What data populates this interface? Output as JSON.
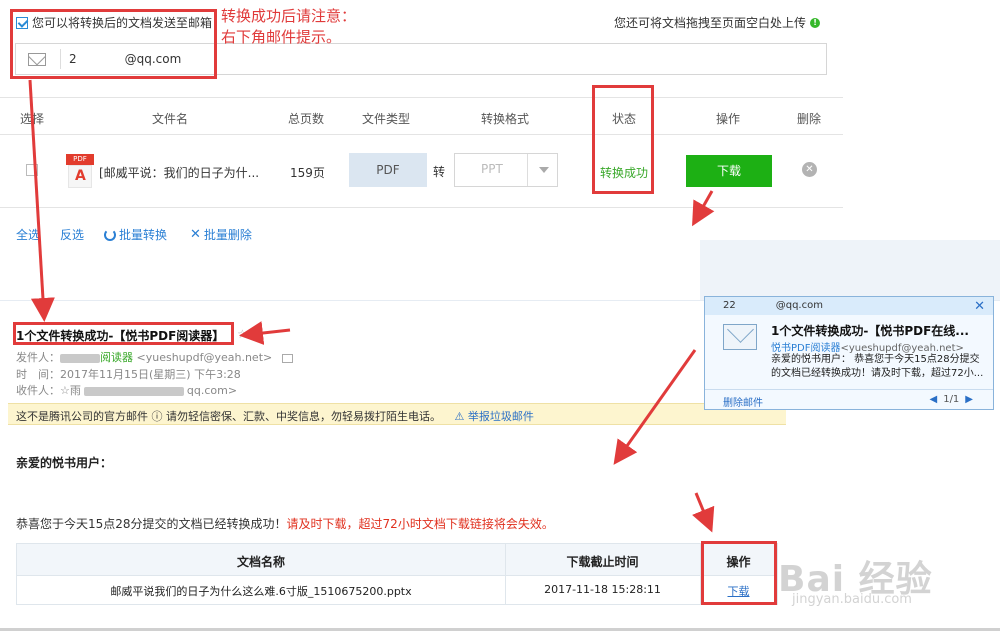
{
  "converter": {
    "email_checkbox_label": "您可以将转换后的文档发送至邮箱",
    "email_value": "2    @qq.com",
    "drag_hint": "您还可将文档拖拽至页面空白处上传",
    "columns": [
      "选择",
      "文件名",
      "总页数",
      "文件类型",
      "转换格式",
      "状态",
      "操作",
      "删除"
    ],
    "row": {
      "file_name": "[邮威平说：我们的日子为什...",
      "pages": "159页",
      "file_type": "PDF",
      "to_label": "转",
      "target_format": "PPT",
      "status": "转换成功",
      "download_label": "下载"
    },
    "bulk": {
      "select_all": "全选",
      "invert": "反选",
      "batch_convert": "批量转换",
      "batch_delete": "批量删除"
    }
  },
  "annotation": {
    "line1": "转换成功后请注意：",
    "line2": "右下角邮件提示。"
  },
  "mail": {
    "subject": "1个文件转换成功-【悦书PDF阅读器】",
    "sender_label": "发件人：",
    "sender_name": "阅读器",
    "sender_email": "<yueshupdf@yeah.net>",
    "time_label": "时　间：",
    "time_value": "2017年11月15日(星期三) 下午3:28",
    "recipient_label": "收件人：",
    "recipient_value": "☆雨",
    "recipient_email": "qq.com>",
    "warning": "这不是腾讯公司的官方邮件 ⓘ   请勿轻信密保、汇款、中奖信息，勿轻易拨打陌生电话。",
    "report": "举报垃圾邮件",
    "greeting": "亲爱的悦书用户：",
    "notice_prefix": "恭喜您于今天15点28分提交的文档已经转换成功！",
    "notice_red": "请及时下载，超过72小时文档下载链接将会失效。",
    "table": {
      "headers": [
        "文档名称",
        "下载截止时间",
        "操作"
      ],
      "row": [
        "邮威平说我们的日子为什么这么难.6寸版_1510675200.pptx",
        "2017-11-18 15:28:11",
        "下载"
      ]
    }
  },
  "popup": {
    "account": "22    @qq.com",
    "subject": "1个文件转换成功-【悦书PDF在线...",
    "sender_name": "悦书PDF阅读器",
    "sender_email": "<yueshupdf@yeah.net>",
    "body": "亲爱的悦书用户： 恭喜您于今天15点28分提交的文档已经转换成功！请及时下载，超过72小...",
    "delete": "删除邮件",
    "page": "1/1"
  },
  "watermark": {
    "brand": "Bai 经验",
    "url": "jingyan.baidu.com"
  },
  "colors": {
    "accent_blue": "#2a7fd4",
    "success_green": "#1db014",
    "annotation_red": "#e13b3b"
  }
}
